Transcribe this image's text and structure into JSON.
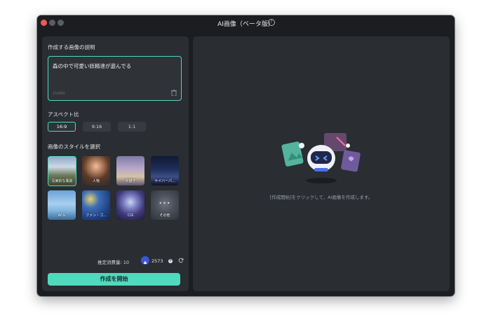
{
  "window": {
    "title": "AI画像（ベータ版）"
  },
  "left_panel": {
    "prompt_section_label": "作成する画像の説明",
    "prompt_value": "森の中で可愛い妖精達が遊んでる",
    "prompt_count": "15/800",
    "aspect_label": "アスペクト比",
    "aspect_options": [
      "16:9",
      "9:16",
      "1:1"
    ],
    "aspect_selected": "16:9",
    "style_label": "画像のスタイルを選択",
    "styles": [
      {
        "label": "写実的な風景"
      },
      {
        "label": "人物"
      },
      {
        "label": "手描き"
      },
      {
        "label": "サイバーパ..."
      },
      {
        "label": "ACG"
      },
      {
        "label": "ファン・ゴ..."
      },
      {
        "label": "CGI"
      },
      {
        "label": "その他"
      }
    ],
    "style_selected": "写実的な風景",
    "cost_label": "推定消費量: 10",
    "credits": "2573",
    "start_button": "作成を開始"
  },
  "right_panel": {
    "hint": "[作成開始]をクリックして、AI画像を作成します。"
  },
  "colors": {
    "accent": "#4dd9bf",
    "panel": "#2a2d32",
    "window": "#1b1d21"
  }
}
